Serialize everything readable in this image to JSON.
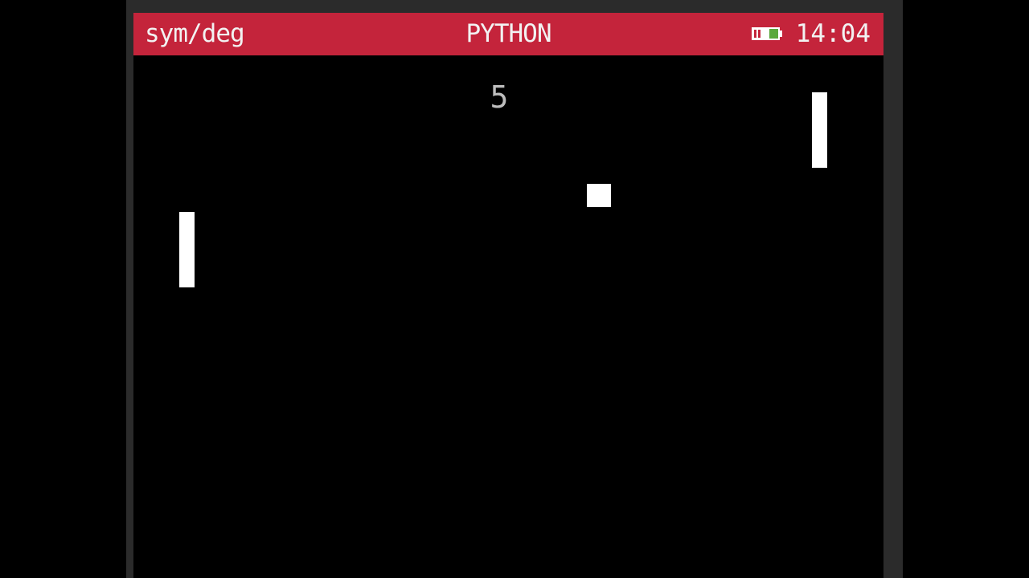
{
  "status_bar": {
    "mode": "sym/deg",
    "title": "PYTHON",
    "time": "14:04",
    "battery_icon": "battery-icon",
    "color": "#c4243b"
  },
  "game": {
    "score": "5"
  }
}
